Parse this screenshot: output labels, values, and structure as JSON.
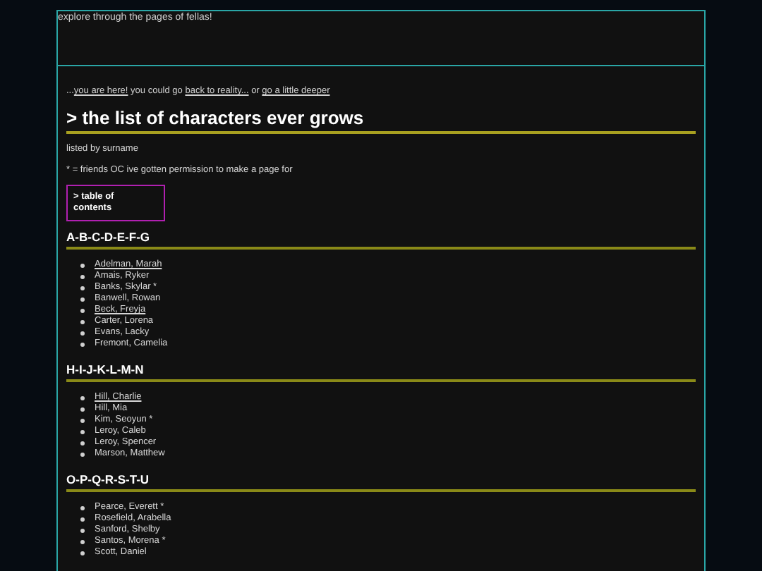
{
  "header": {
    "text": "explore through the pages of fellas!"
  },
  "breadcrumb": {
    "prefix": "...",
    "links": [
      {
        "text": "you are here!",
        "after": " you could go "
      },
      {
        "text": "back to reality...",
        "after": " or "
      },
      {
        "text": "go a little deeper"
      }
    ]
  },
  "title": "> the list of characters ever grows",
  "notes": [
    "listed by surname",
    "* = friends OC ive gotten permission to make a page for"
  ],
  "toc_button": "> table of contents",
  "sections": [
    {
      "heading": "A-B-C-D-E-F-G",
      "items": [
        {
          "name": "Adelman, Marah",
          "linked": true
        },
        {
          "name": "Amais, Ryker",
          "linked": false
        },
        {
          "name": "Banks, Skylar *",
          "linked": false
        },
        {
          "name": "Banwell, Rowan",
          "linked": false
        },
        {
          "name": "Beck, Freyja",
          "linked": true
        },
        {
          "name": "Carter, Lorena",
          "linked": false
        },
        {
          "name": "Evans, Lacky",
          "linked": false
        },
        {
          "name": "Fremont, Camelia",
          "linked": false
        }
      ]
    },
    {
      "heading": "H-I-J-K-L-M-N",
      "items": [
        {
          "name": "Hill, Charlie",
          "linked": true
        },
        {
          "name": "Hill, Mia",
          "linked": false
        },
        {
          "name": "Kim, Seoyun *",
          "linked": false
        },
        {
          "name": "Leroy, Caleb",
          "linked": false
        },
        {
          "name": "Leroy, Spencer",
          "linked": false
        },
        {
          "name": "Marson, Matthew",
          "linked": false
        }
      ]
    },
    {
      "heading": "O-P-Q-R-S-T-U",
      "items": [
        {
          "name": "Pearce, Everett *",
          "linked": false
        },
        {
          "name": "Rosefield, Arabella",
          "linked": false
        },
        {
          "name": "Sanford, Shelby",
          "linked": false
        },
        {
          "name": "Santos, Morena *",
          "linked": false
        },
        {
          "name": "Scott, Daniel",
          "linked": false
        }
      ]
    }
  ]
}
